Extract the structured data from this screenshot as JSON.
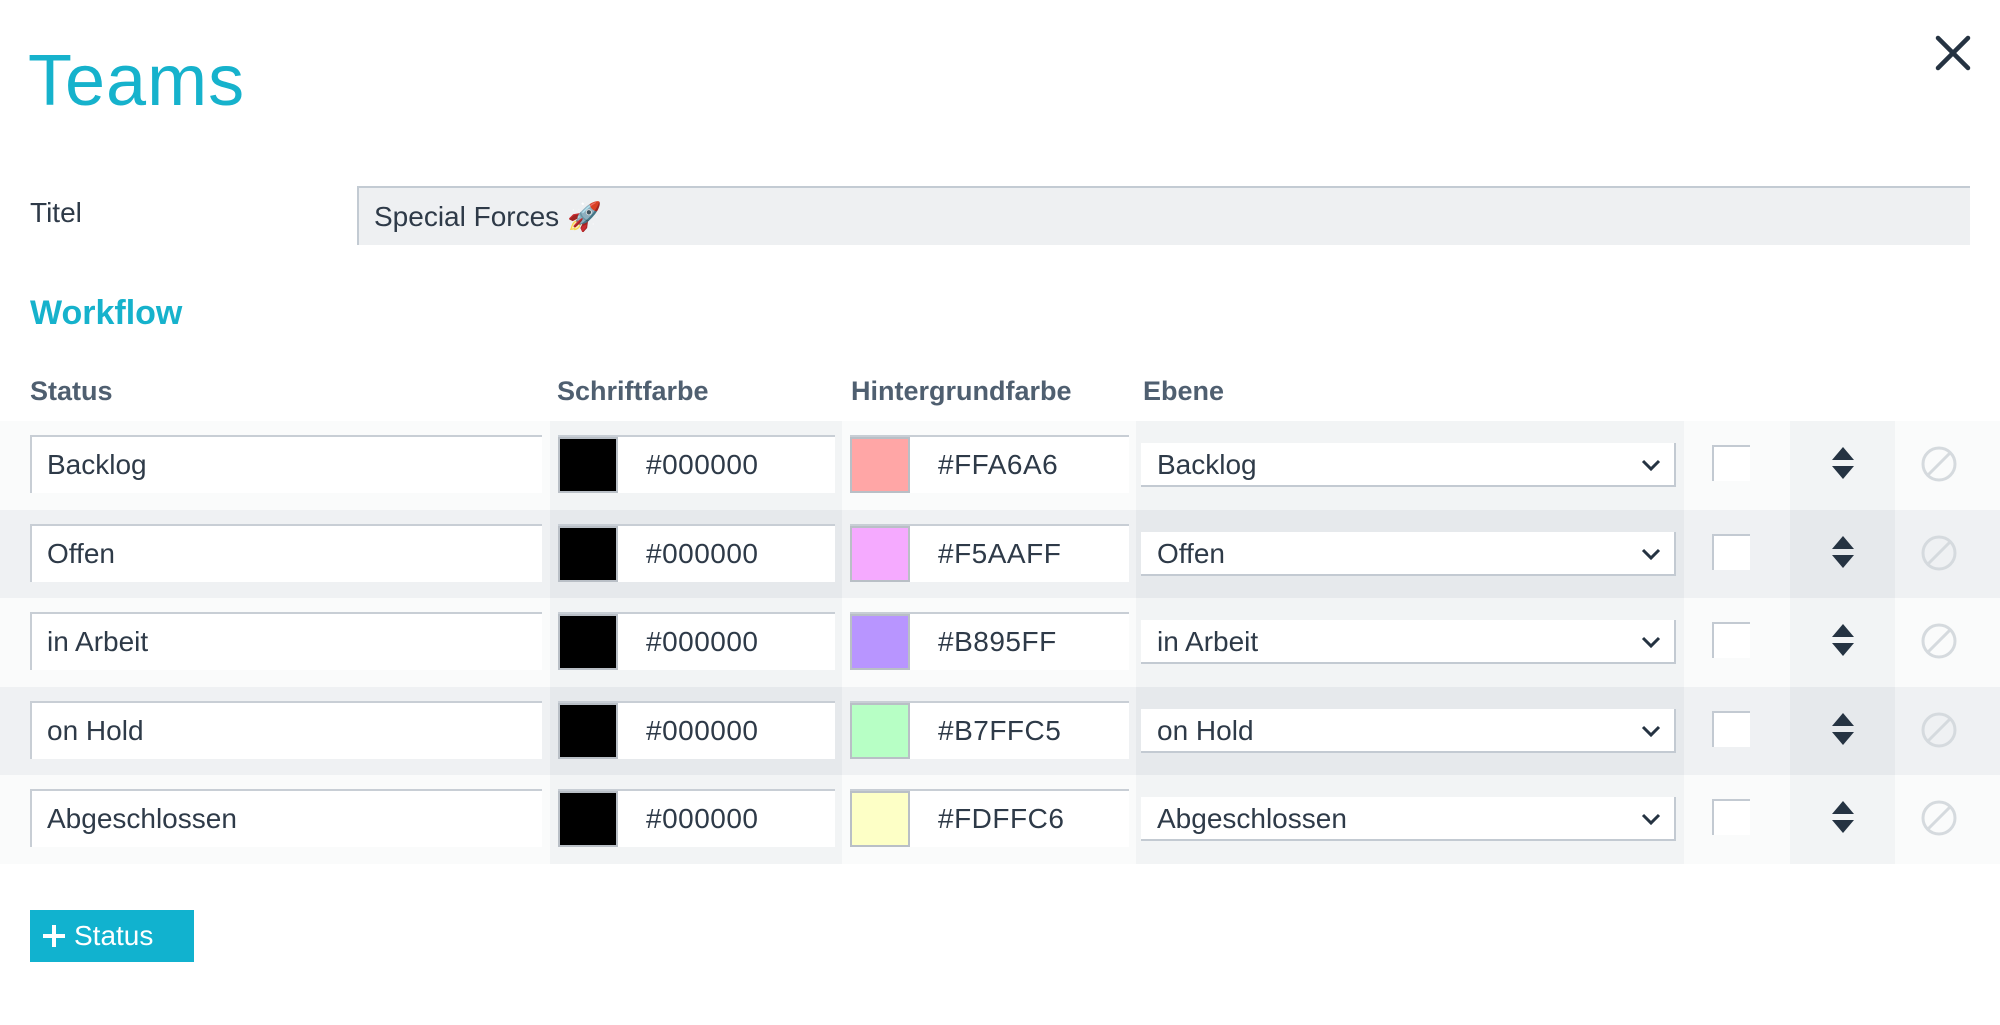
{
  "dialog": {
    "title": "Teams",
    "close_icon": "close-icon"
  },
  "form": {
    "title_label": "Titel",
    "title_value": "Special Forces 🚀"
  },
  "workflow": {
    "section_title": "Workflow",
    "columns": {
      "status": "Status",
      "font_color": "Schriftfarbe",
      "background_color": "Hintergrundfarbe",
      "level": "Ebene"
    },
    "rows": [
      {
        "status": "Backlog",
        "font_color": "#000000",
        "background_color": "#FFA6A6",
        "level": "Backlog",
        "checked": false
      },
      {
        "status": "Offen",
        "font_color": "#000000",
        "background_color": "#F5AAFF",
        "level": "Offen",
        "checked": false
      },
      {
        "status": "in Arbeit",
        "font_color": "#000000",
        "background_color": "#B895FF",
        "level": "in Arbeit",
        "checked": false
      },
      {
        "status": "on Hold",
        "font_color": "#000000",
        "background_color": "#B7FFC5",
        "level": "on Hold",
        "checked": false
      },
      {
        "status": "Abgeschlossen",
        "font_color": "#000000",
        "background_color": "#FDFFC6",
        "level": "Abgeschlossen",
        "checked": false
      }
    ],
    "add_button_label": "Status",
    "icons": {
      "sort": "sort-handle-icon",
      "disable": "disable-icon",
      "dropdown": "chevron-down-icon",
      "add": "plus-icon"
    }
  },
  "colors": {
    "accent": "#16B2CC",
    "button": "#11B2CF",
    "text": "#2E3A48",
    "header_text": "#4F5F70"
  }
}
